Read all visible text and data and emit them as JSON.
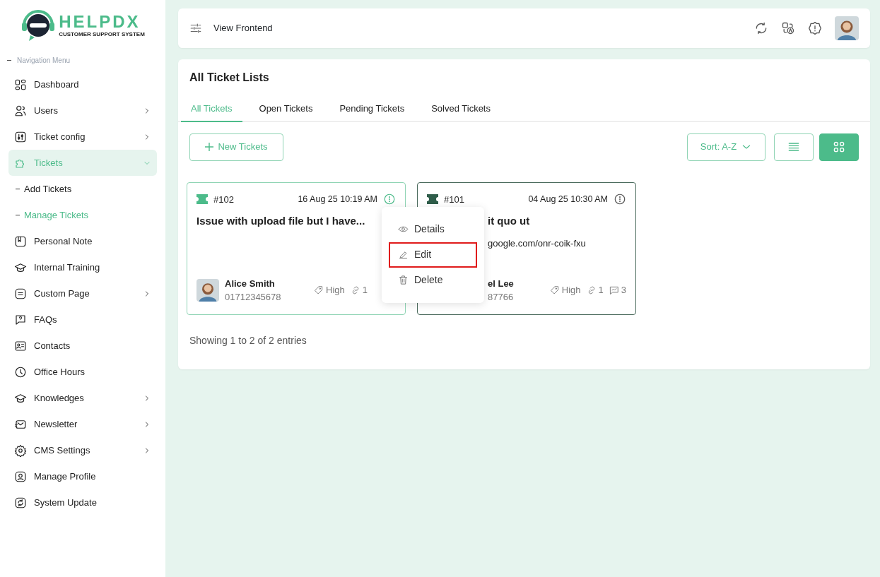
{
  "logo": {
    "name": "HELPDX",
    "tagline": "CUSTOMER SUPPORT SYSTEM"
  },
  "sidebar": {
    "heading": "Navigation Menu",
    "items": [
      {
        "label": "Dashboard",
        "selected": false
      },
      {
        "label": "Users",
        "expanded": false,
        "selected": false
      },
      {
        "label": "Ticket config",
        "expanded": false,
        "selected": false
      },
      {
        "label": "Tickets",
        "expanded": true,
        "selected": true,
        "children": [
          {
            "label": "Add Tickets",
            "selected": false
          },
          {
            "label": "Manage Tickets",
            "selected": true
          }
        ]
      },
      {
        "label": "Personal Note",
        "selected": false
      },
      {
        "label": "Internal Training",
        "selected": false
      },
      {
        "label": "Custom Page",
        "expanded": false,
        "selected": false
      },
      {
        "label": "FAQs",
        "selected": false
      },
      {
        "label": "Contacts",
        "selected": false
      },
      {
        "label": "Office Hours",
        "selected": false
      },
      {
        "label": "Knowledges",
        "expanded": false,
        "selected": false
      },
      {
        "label": "Newsletter",
        "expanded": false,
        "selected": false
      },
      {
        "label": "CMS Settings",
        "expanded": false,
        "selected": false
      },
      {
        "label": "Manage Profile",
        "selected": false
      },
      {
        "label": "System Update",
        "selected": false
      }
    ]
  },
  "header": {
    "link": "View Frontend"
  },
  "panel": {
    "title": "All Ticket Lists",
    "tabs": [
      {
        "label": "All Tickets",
        "selected": true
      },
      {
        "label": "Open Tickets",
        "selected": false
      },
      {
        "label": "Pending Tickets",
        "selected": false
      },
      {
        "label": "Solved Tickets",
        "selected": false
      }
    ],
    "new_button": "New Tickets",
    "sort": "Sort: A-Z",
    "views": [
      {
        "kind": "list",
        "selected": false
      },
      {
        "kind": "grid",
        "selected": true
      }
    ],
    "tickets": [
      {
        "selected": true,
        "number": "#102",
        "date": "16 Aug 25 10:19 AM",
        "title": "Issue with upload file but I have...",
        "customer": "Alice Smith",
        "phone": "01712345678",
        "priority": "High",
        "links": "1"
      },
      {
        "selected": false,
        "number": "#101",
        "date": "04 Aug 25 10:30 AM",
        "title": "it quo ut",
        "url": "google.com/onr-coik-fxu",
        "customer": "el Lee",
        "phone": "87766",
        "priority": "High",
        "links": "1",
        "comments": "3"
      }
    ],
    "menu": [
      {
        "kind": "view",
        "label": "Details",
        "highlighted": false
      },
      {
        "kind": "edit",
        "label": "Edit",
        "highlighted": true
      },
      {
        "kind": "delete",
        "label": "Delete",
        "highlighted": false
      }
    ],
    "footer": "Showing 1 to 2 of 2 entries"
  }
}
